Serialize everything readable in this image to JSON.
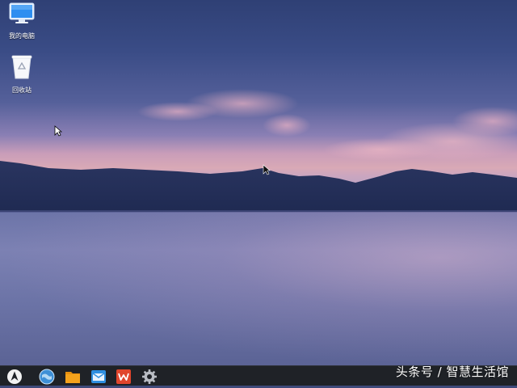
{
  "desktop": {
    "icons": [
      {
        "label": "我的电脑",
        "icon": "computer-icon"
      },
      {
        "label": "回收站",
        "icon": "recycle-bin-icon"
      }
    ]
  },
  "taskbar": {
    "items": [
      {
        "icon": "start-menu-icon"
      },
      {
        "icon": "browser-icon"
      },
      {
        "icon": "file-manager-icon"
      },
      {
        "icon": "mail-icon"
      },
      {
        "icon": "wps-office-icon"
      },
      {
        "icon": "settings-gear-icon"
      }
    ]
  },
  "watermark": {
    "text": "头条号 / 智慧生活馆"
  },
  "colors": {
    "taskbar_bg": "#1f2227",
    "folder": "#f4a21c",
    "wps": "#e0452c",
    "mail": "#2f8fe0",
    "browser": "#3d8fd6"
  }
}
